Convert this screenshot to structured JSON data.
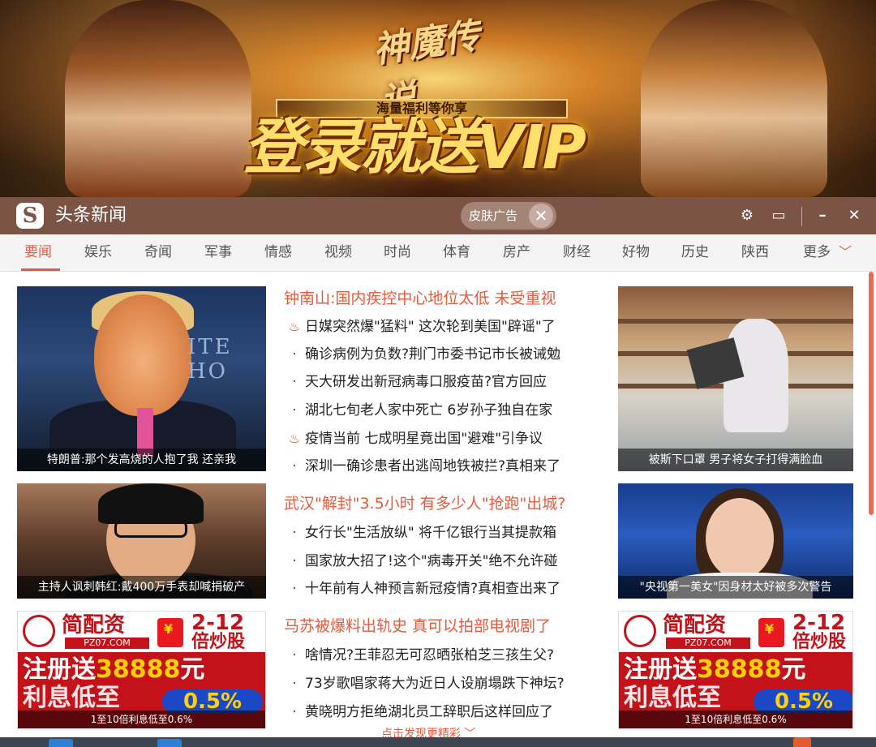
{
  "banner": {
    "logo_text": "神魔传说",
    "subtitle": "海量福利等你享",
    "headline": "登录就送VIP"
  },
  "titlebar": {
    "app_logo": "S",
    "app_title": "头条新闻",
    "skin_ad_label": "皮肤广告",
    "skin_ad_close": "✕",
    "settings_icon": "⚙",
    "feedback_icon": "▭",
    "minimize_icon": "–",
    "close_icon": "✕"
  },
  "nav": {
    "tabs": [
      "要闻",
      "娱乐",
      "奇闻",
      "军事",
      "情感",
      "视频",
      "时尚",
      "体育",
      "房产",
      "财经",
      "好物",
      "历史",
      "陕西",
      "更多"
    ],
    "active_index": 0,
    "more_chevron": "﹀"
  },
  "left_cards": [
    {
      "caption": "特朗普:那个发高烧的人抱了我 还亲我",
      "seal_text": "ITE HO"
    },
    {
      "caption": "主持人讽刺韩红:戴400万手表却喊捐破产"
    }
  ],
  "right_cards": [
    {
      "caption": "被斯下口罩 男子将女子打得满脸血"
    },
    {
      "caption": "\"央视第一美女\"因身材太好被多次警告"
    }
  ],
  "ad": {
    "brand": "简配资",
    "brand_sub": "PZ07.COM",
    "hb_mark": "¥",
    "range_top": "2-12",
    "range_bottom": "倍炒股",
    "register_prefix": "注册送",
    "register_amount": "38888",
    "register_suffix": "元",
    "rate_text": "利息低至",
    "rate_value": "0.5%",
    "caption": "1至10倍利息低至0.6%"
  },
  "news": {
    "group1": {
      "headline": "钟南山:国内疾控中心地位太低 未受重视",
      "items": [
        {
          "hot": true,
          "text": "日媒突然爆\"猛料\" 这次轮到美国\"辟谣\"了"
        },
        {
          "hot": false,
          "text": "确诊病例为负数?荆门市委书记市长被诫勉"
        },
        {
          "hot": false,
          "text": "天大研发出新冠病毒口服疫苗?官方回应"
        },
        {
          "hot": false,
          "text": "湖北七旬老人家中死亡 6岁孙子独自在家"
        },
        {
          "hot": true,
          "text": "疫情当前 七成明星竟出国\"避难\"引争议"
        },
        {
          "hot": false,
          "text": "深圳一确诊患者出逃闯地铁被拦?真相来了"
        }
      ]
    },
    "group2": {
      "headline": "武汉\"解封\"3.5小时 有多少人\"抢跑\"出城?",
      "items": [
        {
          "hot": false,
          "text": "女行长\"生活放纵\" 将千亿银行当其提款箱"
        },
        {
          "hot": false,
          "text": "国家放大招了!这个\"病毒开关\"绝不允许碰"
        },
        {
          "hot": false,
          "text": "十年前有人神预言新冠疫情?真相查出来了"
        }
      ]
    },
    "group3": {
      "headline": "马苏被爆料出轨史 真可以拍部电视剧了",
      "items": [
        {
          "hot": false,
          "text": "啥情况?王菲忍无可忍晒张柏芝三孩生父?"
        },
        {
          "hot": false,
          "text": "73岁歌唱家蒋大为近日人设崩塌跌下神坛?"
        },
        {
          "hot": false,
          "text": "黄晓明方拒绝湖北员工辞职后这样回应了"
        }
      ]
    },
    "load_more": "点击发现更精彩 ﹀"
  },
  "colors": {
    "titlebar_bg": "#7b5446",
    "accent": "#e55a3c",
    "nav_bg": "#f4f4f4"
  }
}
